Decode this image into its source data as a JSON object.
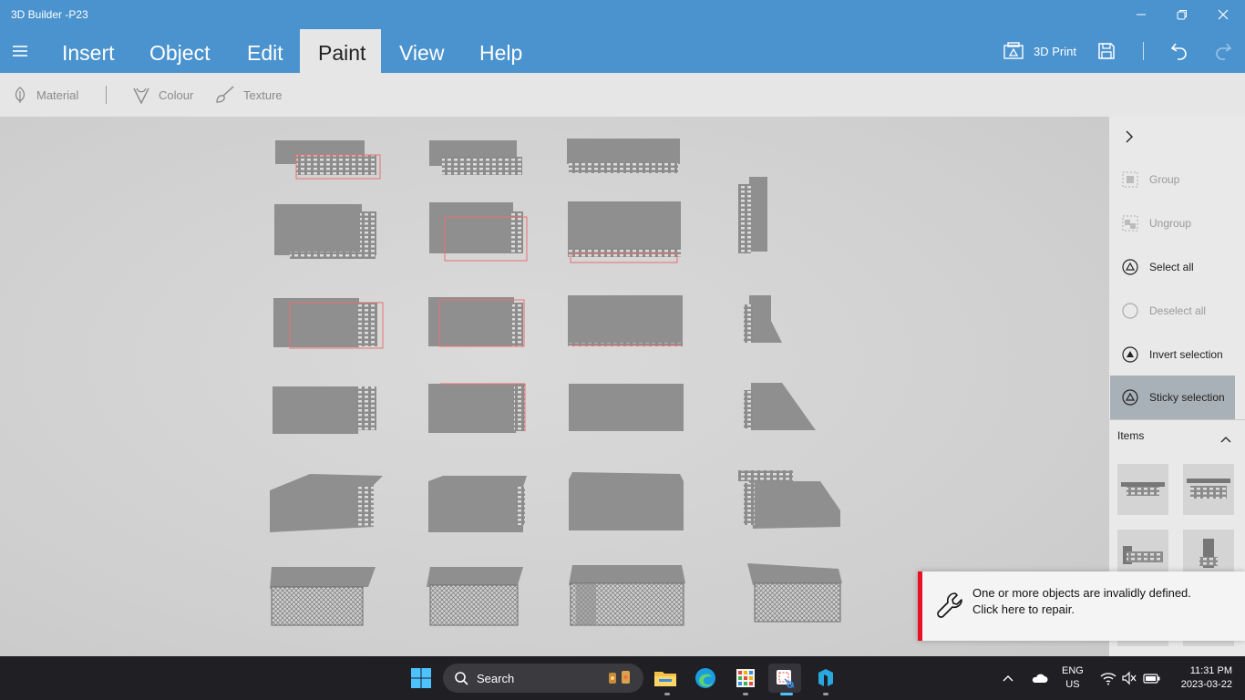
{
  "window": {
    "title": "3D Builder -P23"
  },
  "menu": {
    "tabs": [
      "Insert",
      "Object",
      "Edit",
      "Paint",
      "View",
      "Help"
    ],
    "active_tab": "Paint",
    "print_label": "3D Print"
  },
  "toolbar": {
    "material": "Material",
    "colour": "Colour",
    "texture": "Texture"
  },
  "panel": {
    "group": "Group",
    "ungroup": "Ungroup",
    "select_all": "Select all",
    "deselect_all": "Deselect all",
    "invert_selection": "Invert selection",
    "sticky_selection": "Sticky selection",
    "items_header": "Items"
  },
  "notification": {
    "line1": "One or more objects are invalidly defined.",
    "line2": "Click here to repair."
  },
  "taskbar": {
    "search": "Search",
    "lang": "ENG",
    "region": "US",
    "time": "11:31 PM",
    "date": "2023-03-22"
  },
  "colors": {
    "accent": "#4a93cf",
    "error": "#e81123",
    "selection_outline": "#e87070"
  }
}
